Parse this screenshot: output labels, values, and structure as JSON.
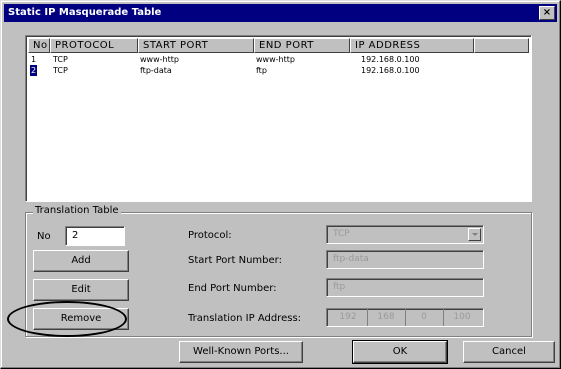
{
  "window": {
    "title": "Static IP Masquerade Table",
    "close_glyph": "×"
  },
  "table": {
    "columns": [
      "No",
      "PROTOCOL",
      "START PORT",
      "END PORT",
      "IP ADDRESS"
    ],
    "rows": [
      {
        "no": "1",
        "protocol": "TCP",
        "start_port": "www-http",
        "end_port": "www-http",
        "ip": "192.168.0.100",
        "selected": false
      },
      {
        "no": "2",
        "protocol": "TCP",
        "start_port": "ftp-data",
        "end_port": "ftp",
        "ip": "192.168.0.100",
        "selected": true
      }
    ]
  },
  "translation": {
    "legend": "Translation Table",
    "no_label": "No",
    "no_value": "2",
    "add_label": "Add",
    "edit_label": "Edit",
    "remove_label": "Remove",
    "protocol_label": "Protocol:",
    "protocol_value": "TCP",
    "start_port_label": "Start Port Number:",
    "start_port_value": "ftp-data",
    "end_port_label": "End Port Number:",
    "end_port_value": "ftp",
    "ip_label": "Translation IP Address:",
    "ip_octets": [
      "192",
      "168",
      "0",
      "100"
    ]
  },
  "footer": {
    "well_known_label": "Well-Known Ports...",
    "ok_label": "OK",
    "cancel_label": "Cancel"
  },
  "colors": {
    "titlebar": "#000080",
    "face": "#c0c0c0",
    "selection": "#000080"
  },
  "icons": {
    "close": "close-icon",
    "dropdown": "chevron-down-icon"
  }
}
